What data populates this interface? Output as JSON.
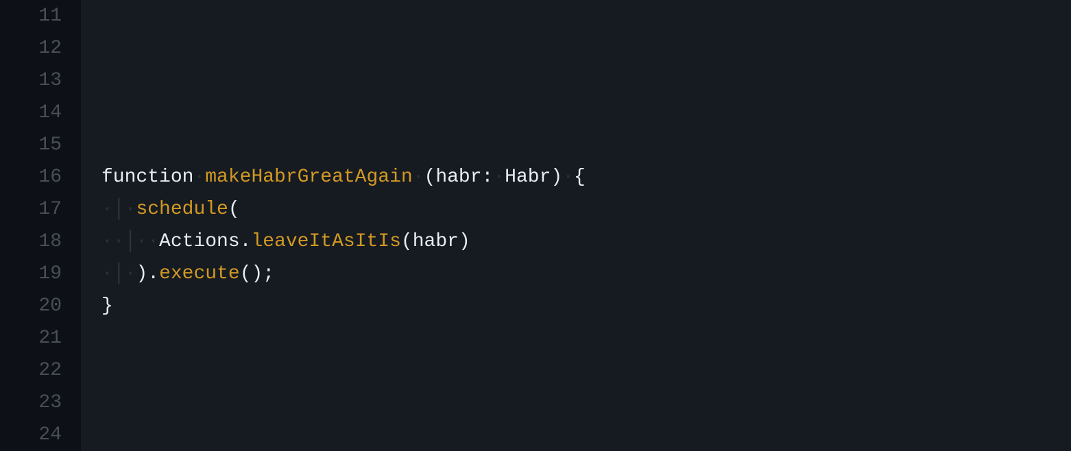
{
  "gutter": {
    "start": 11,
    "end": 24
  },
  "code": {
    "lines": [
      {
        "n": 11,
        "tokens": []
      },
      {
        "n": 12,
        "tokens": []
      },
      {
        "n": 13,
        "tokens": []
      },
      {
        "n": 14,
        "tokens": []
      },
      {
        "n": 15,
        "tokens": []
      },
      {
        "n": 16,
        "tokens": [
          {
            "t": "function",
            "c": "kw"
          },
          {
            "t": "·",
            "c": "ws-dot"
          },
          {
            "t": "makeHabrGreatAgain",
            "c": "fn-name"
          },
          {
            "t": "·",
            "c": "ws-dot"
          },
          {
            "t": "(",
            "c": "punc"
          },
          {
            "t": "habr",
            "c": "default"
          },
          {
            "t": ":",
            "c": "punc"
          },
          {
            "t": "·",
            "c": "ws-dot"
          },
          {
            "t": "Habr",
            "c": "type"
          },
          {
            "t": ")",
            "c": "punc"
          },
          {
            "t": "·",
            "c": "ws-dot"
          },
          {
            "t": "{",
            "c": "punc"
          }
        ]
      },
      {
        "n": 17,
        "tokens": [
          {
            "t": "·",
            "c": "ws-dot"
          },
          {
            "t": "│",
            "c": "indent-guide"
          },
          {
            "t": "·",
            "c": "ws-dot"
          },
          {
            "t": "schedule",
            "c": "fn-call"
          },
          {
            "t": "(",
            "c": "punc"
          }
        ]
      },
      {
        "n": 18,
        "tokens": [
          {
            "t": "··",
            "c": "ws-dot"
          },
          {
            "t": "│",
            "c": "indent-guide"
          },
          {
            "t": "··",
            "c": "ws-dot"
          },
          {
            "t": "Actions",
            "c": "prop"
          },
          {
            "t": ".",
            "c": "punc"
          },
          {
            "t": "leaveItAsItIs",
            "c": "fn-call"
          },
          {
            "t": "(",
            "c": "punc"
          },
          {
            "t": "habr",
            "c": "default"
          },
          {
            "t": ")",
            "c": "punc"
          }
        ]
      },
      {
        "n": 19,
        "tokens": [
          {
            "t": "·",
            "c": "ws-dot"
          },
          {
            "t": "│",
            "c": "indent-guide"
          },
          {
            "t": "·",
            "c": "ws-dot"
          },
          {
            "t": ")",
            "c": "punc"
          },
          {
            "t": ".",
            "c": "punc"
          },
          {
            "t": "execute",
            "c": "fn-call"
          },
          {
            "t": "(",
            "c": "punc"
          },
          {
            "t": ")",
            "c": "punc"
          },
          {
            "t": ";",
            "c": "punc"
          }
        ]
      },
      {
        "n": 20,
        "tokens": [
          {
            "t": "}",
            "c": "punc"
          }
        ]
      },
      {
        "n": 21,
        "tokens": []
      },
      {
        "n": 22,
        "tokens": []
      },
      {
        "n": 23,
        "tokens": []
      },
      {
        "n": 24,
        "tokens": []
      }
    ]
  },
  "colors": {
    "background_gutter": "#0d1117",
    "background_code": "#161b22",
    "line_number": "#484f58",
    "keyword": "#e6edf3",
    "function_name": "#d29922",
    "default_text": "#e6edf3",
    "whitespace_dot": "#2a3038",
    "indent_guide": "#30363d"
  }
}
